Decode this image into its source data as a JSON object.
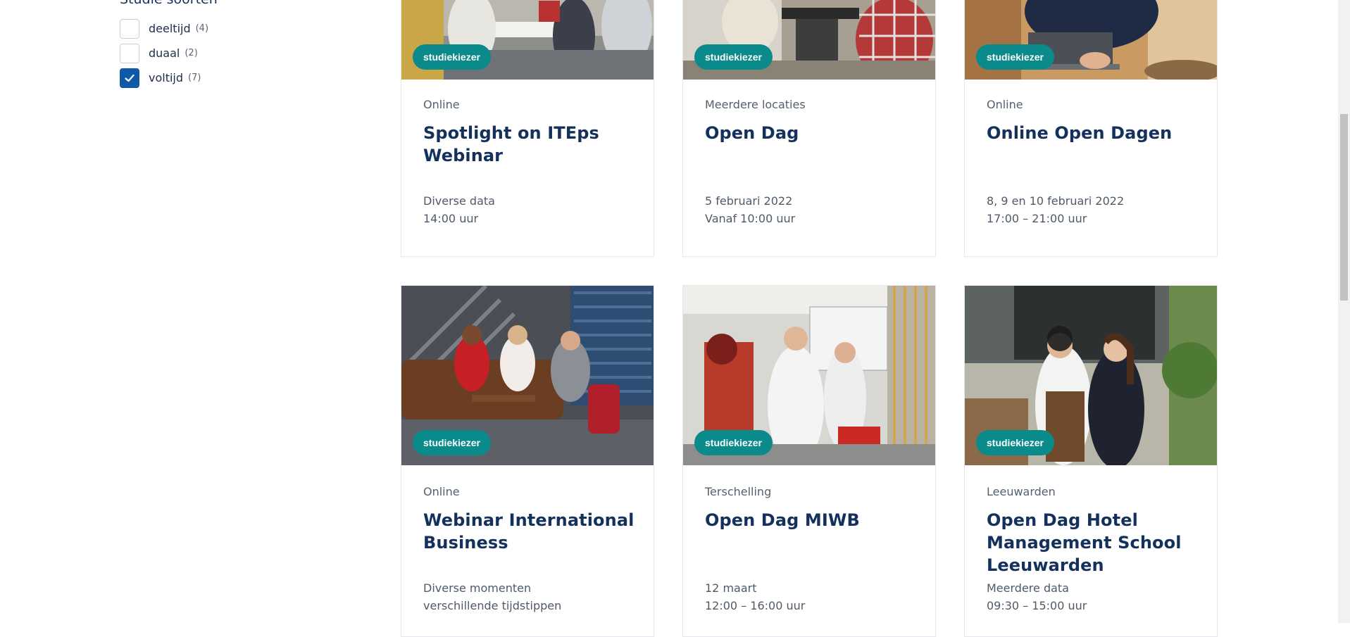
{
  "filter": {
    "title": "Studie soorten",
    "options": [
      {
        "label": "deeltijd",
        "count": "(4)",
        "checked": false
      },
      {
        "label": "duaal",
        "count": "(2)",
        "checked": false
      },
      {
        "label": "voltijd",
        "count": "(7)",
        "checked": true
      }
    ]
  },
  "cards": [
    {
      "badge": "studiekiezer",
      "location": "Online",
      "title": "Spotlight on ITEps Webinar",
      "date_line1": "Diverse data",
      "date_line2": "14:00 uur"
    },
    {
      "badge": "studiekiezer",
      "location": "Meerdere locaties",
      "title": "Open Dag",
      "date_line1": "5 februari 2022",
      "date_line2": "Vanaf 10:00 uur"
    },
    {
      "badge": "studiekiezer",
      "location": "Online",
      "title": "Online Open Dagen",
      "date_line1": "8, 9 en 10 februari 2022",
      "date_line2": "17:00 – 21:00 uur"
    },
    {
      "badge": "studiekiezer",
      "location": "Online",
      "title": "Webinar International Business",
      "date_line1": "Diverse momenten",
      "date_line2": "verschillende tijdstippen"
    },
    {
      "badge": "studiekiezer",
      "location": "Terschelling",
      "title": "Open Dag MIWB",
      "date_line1": "12 maart",
      "date_line2": "12:00 – 16:00 uur"
    },
    {
      "badge": "studiekiezer",
      "location": "Leeuwarden",
      "title": "Open Dag Hotel Management School Leeuwarden",
      "date_line1": "Meerdere data",
      "date_line2": "09:30 – 15:00 uur"
    }
  ],
  "colors": {
    "badge": "#0b8a8c",
    "title": "#14305c",
    "checkbox": "#0e5aa7"
  }
}
